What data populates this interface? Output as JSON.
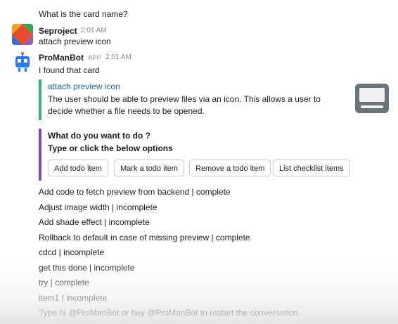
{
  "previous_message": "What is the card name?",
  "messages": [
    {
      "author": "Seproject",
      "time": "2:01 AM",
      "text": "attach preview icon"
    },
    {
      "author": "ProManBot",
      "app_tag": "APP",
      "time": "2:01 AM",
      "text": "I found that card"
    }
  ],
  "attachment": {
    "title": "attach preview icon",
    "description": "The user should be able to preview files via an icon. This allows a user to decide whether a file needs to be opened."
  },
  "action_block": {
    "question": "What do you want to do ?",
    "instruction": "Type or click the below options",
    "buttons": [
      "Add todo item",
      "Mark a todo item",
      "Remove a todo item",
      "List checklist items"
    ]
  },
  "checklist": [
    "Add code to fetch preview from backend | complete",
    "Adjust image width | incomplete",
    "Add shade effect | incomplete",
    "Rollback to default in case of missing preview | complete",
    "cdcd | incomplete",
    "get this done | incomplete",
    "try | complete",
    "item1 | incomplete"
  ],
  "footer_hint": "Type hi @ProManBot or hey @ProManBot to restart the conversation.",
  "colors": {
    "accent_green": "#3cb371",
    "accent_purple": "#7d4bb0",
    "link_blue": "#1264a3"
  }
}
